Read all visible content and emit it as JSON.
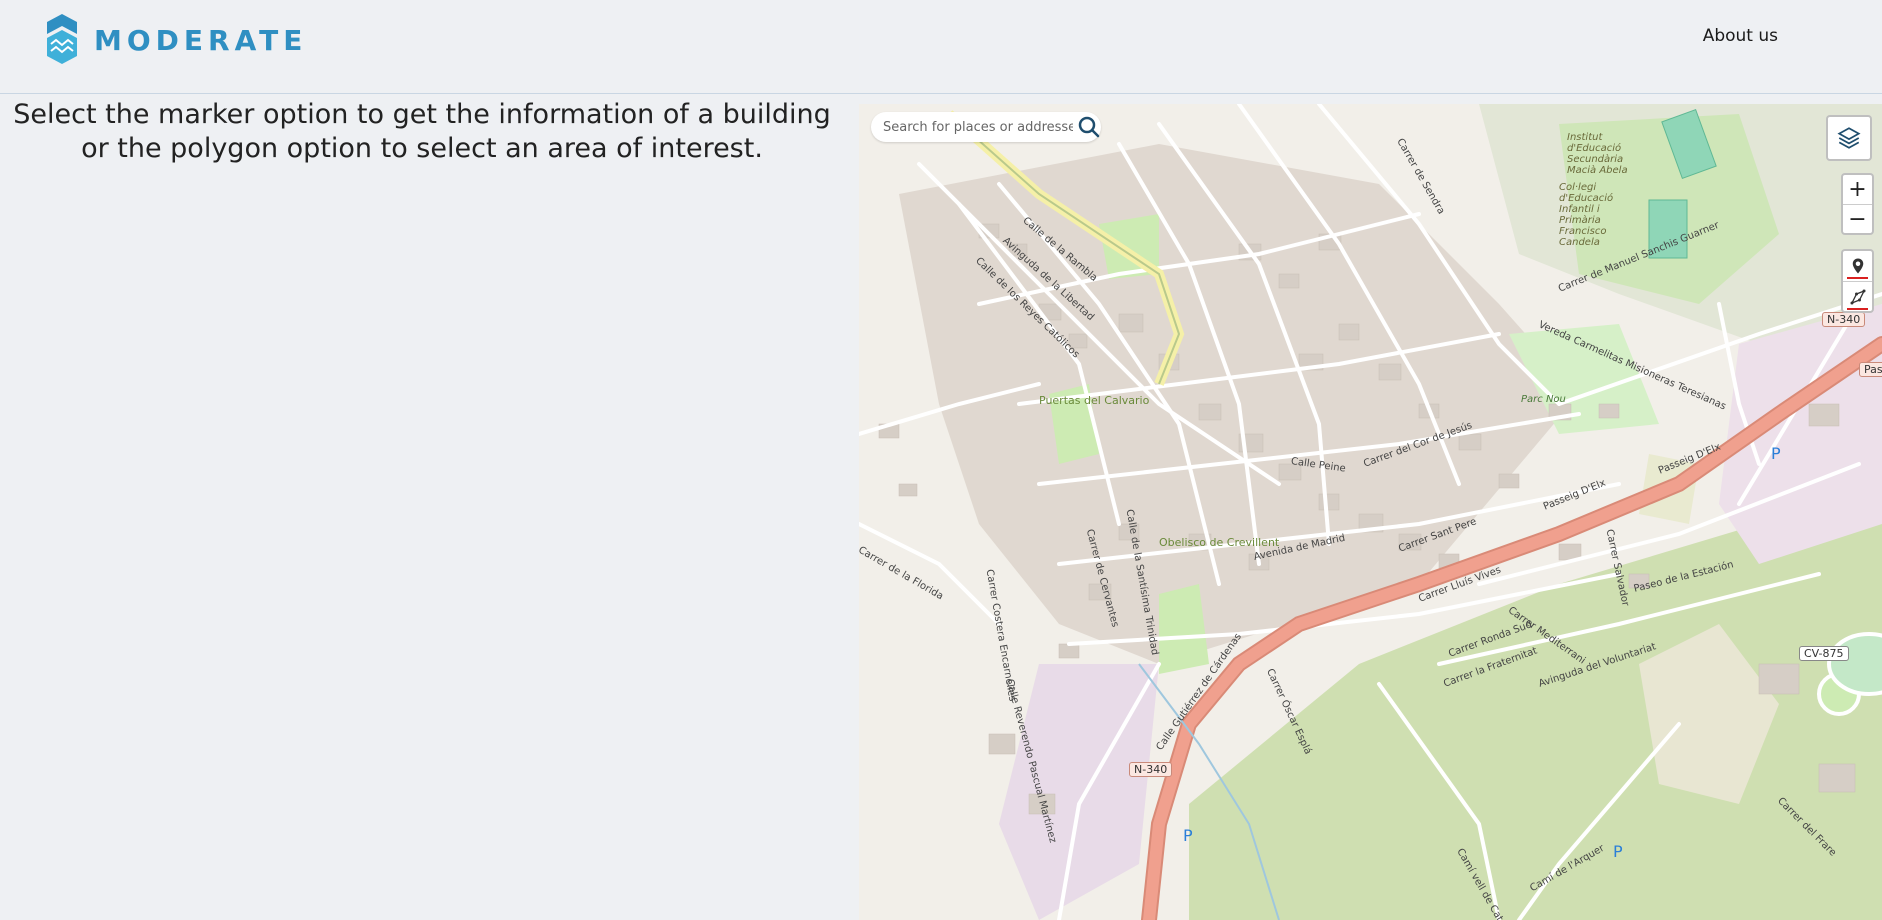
{
  "header": {
    "brand": "MODERATE",
    "about_label": "About us"
  },
  "main": {
    "instructions": "Select the marker option to get the information of a building or the polygon option to select an area of interest."
  },
  "map": {
    "search_placeholder": "Search for places or addresses",
    "controls": {
      "zoom_in": "+",
      "zoom_out": "−"
    },
    "labels": {
      "rambla": "Calle de la Rambla",
      "liberdad": "Avinguda de la Libertad",
      "reyes": "Calle de los Reyes Católicos",
      "passeig1": "Passeig D'Elx",
      "passeig2": "Passeig D'Elx",
      "gutierrez": "Calle Gutiérrez de Cárdenas",
      "madrid": "Avenida de Madrid",
      "calvario": "Puertas del Calvario",
      "obelisco": "Obelisco de Crevillent",
      "parcnou": "Parc Nou",
      "institut": "Institut d'Educació Secundària Macià Abela",
      "colegi": "Col·legi d'Educació Infantil i Primària Francisco Candela",
      "estacion": "Paseo de la Estación",
      "voluntariat": "Avinguda del Voluntariat",
      "florida": "Carrer de la Florida",
      "arquer": "Camí de l'Arquer",
      "catral": "Camí vell de Catral",
      "frare": "Carrer del Frare",
      "sendra": "Carrer de Sendra",
      "corjesus": "Carrer del Cor de Jesús",
      "peine": "Calle Peine",
      "santpere": "Carrer Sant Pere",
      "lluisvives": "Carrer Lluís Vives",
      "rondasud": "Carrer Ronda Sud",
      "fraternitat": "Carrer la Fraternitat",
      "cervantes": "Carrer de Cervantes",
      "trinidad": "Calle de la Santísima Trinidad",
      "costera": "Carrer Costera Encarnelles",
      "reverendo": "Calle Reverendo Pascual Martínez",
      "oscar": "Carrer Óscar Esplá",
      "salvador": "Carrer Salvador",
      "mediterrani": "Carrer Mediterrani",
      "carmelitas": "Vereda Carmelitas Misioneras Teresianas",
      "manuel": "Carrer de Manuel Sanchis Guarner"
    },
    "shields": {
      "n340_a": "N-340",
      "n340_b": "N-340",
      "cv875": "CV-875",
      "pas": "Pas"
    },
    "parking": [
      "P",
      "P",
      "P"
    ],
    "accent_color": "#2f8fc2",
    "road_color": "#f0a08e"
  }
}
